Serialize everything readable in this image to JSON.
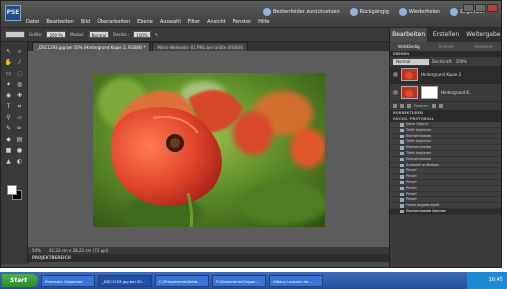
{
  "app": {
    "logo": "PSE",
    "menu": [
      "Datei",
      "Bearbeiten",
      "Bild",
      "Überarbeiten",
      "Ebene",
      "Auswahl",
      "Filter",
      "Ansicht",
      "Fenster",
      "Hilfe"
    ],
    "actions": [
      "Bedienfelder zurücksetzen",
      "Rückgängig",
      "Wiederholen",
      "Organizer"
    ]
  },
  "options": {
    "size_label": "Größe:",
    "size_value": "200 Px",
    "mode_label": "Modus:",
    "mode_value": "Normal",
    "opacity_label": "Deckkr.:",
    "opacity_value": "100%"
  },
  "tabs": [
    "_DSC1293.jpg bei 50% (Hintergrund Kopie 2, RGB/8) *",
    "Mohn-Wolkenbr.-01.PNG bei Größe (RGB/8)"
  ],
  "status": {
    "zoom": "50%",
    "dimensions": "42,33 cm x 28,22 cm (72 ppi)",
    "project": "PROJEKTBEREICH"
  },
  "panel": {
    "tabs": [
      "Bearbeiten",
      "Erstellen",
      "Weitergabe"
    ],
    "subtabs": [
      "Vollständig",
      "Schnell",
      "Assistent"
    ],
    "layers_header": "EBENEN",
    "blend_mode": "Normal",
    "opacity_label": "Deckkraft:",
    "opacity_value": "100%",
    "layers": [
      "Hintergrund Kopie 2",
      "Hintergrund K..."
    ],
    "lock_label": "Fixieren:",
    "correction_header": "KORREKTUREN",
    "history_header": "RÜCKG.-PROTOKOLL",
    "history": [
      "Neue Ebene",
      "Tiefe kopieren",
      "Ebenenmaske",
      "Tiefe kopieren",
      "Ebenenmaske",
      "Tiefe kopieren",
      "Ebenenmaske",
      "Auswahl aufheben",
      "Pinsel",
      "Pinsel",
      "Pinsel",
      "Pinsel",
      "Pinsel",
      "Pinsel",
      "Farbe abgedunkelt",
      "Ebenenmaske löschen"
    ]
  },
  "taskbar": {
    "start": "Start",
    "tasks": [
      "Elements Organizer",
      "_DSC1293.jpg bei 50...",
      "C:\\Programme\\Adob...",
      "F:\\Dokumente\\Organ...",
      "Albany Lessons for..."
    ],
    "clock": "16:45"
  },
  "colors": {
    "accent": "#3b6ec4",
    "poppy": "#e0452a",
    "foliage": "#5d8a2c"
  }
}
